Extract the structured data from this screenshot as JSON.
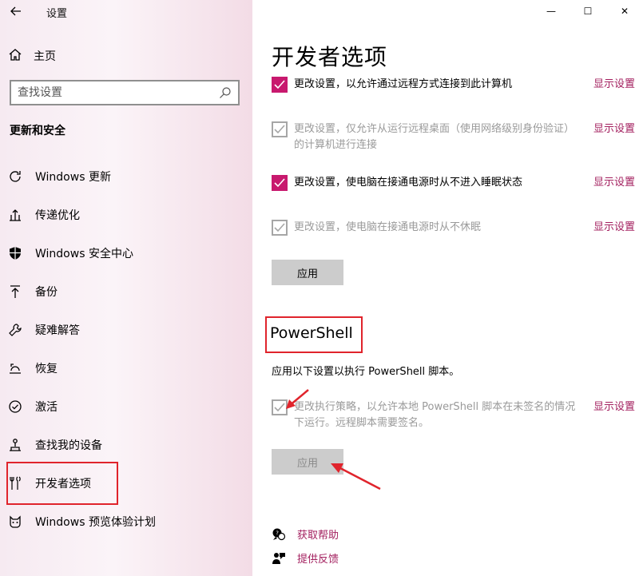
{
  "window": {
    "title": "设置",
    "minimize_glyph": "—",
    "maximize_glyph": "☐",
    "close_glyph": "✕"
  },
  "sidebar": {
    "home_label": "主页",
    "search_placeholder": "查找设置",
    "section_title": "更新和安全",
    "items": [
      {
        "label": "Windows 更新",
        "icon": "refresh-icon"
      },
      {
        "label": "传递优化",
        "icon": "upload-icon"
      },
      {
        "label": "Windows 安全中心",
        "icon": "shield-icon"
      },
      {
        "label": "备份",
        "icon": "backup-arrow-icon"
      },
      {
        "label": "疑难解答",
        "icon": "wrench-icon"
      },
      {
        "label": "恢复",
        "icon": "recovery-icon"
      },
      {
        "label": "激活",
        "icon": "check-circle-icon"
      },
      {
        "label": "查找我的设备",
        "icon": "find-device-icon"
      },
      {
        "label": "开发者选项",
        "icon": "developer-tools-icon",
        "selected": true
      },
      {
        "label": "Windows 预览体验计划",
        "icon": "insider-cat-icon"
      }
    ]
  },
  "main": {
    "page_title": "开发者选项",
    "settings": [
      {
        "text": "更改设置，以允许通过远程方式连接到此计算机",
        "state": "checked",
        "link": "显示设置"
      },
      {
        "text": "更改设置，仅允许从运行远程桌面（使用网络级别身份验证）的计算机进行连接",
        "state": "disabled",
        "link": "显示设置"
      },
      {
        "text": "更改设置，使电脑在接通电源时从不进入睡眠状态",
        "state": "checked",
        "link": "显示设置"
      },
      {
        "text": "更改设置，使电脑在接通电源时从不休眠",
        "state": "disabled",
        "link": "显示设置"
      }
    ],
    "apply_label": "应用",
    "powershell": {
      "title": "PowerShell",
      "description": "应用以下设置以执行 PowerShell 脚本。",
      "setting_text": "更改执行策略，以允许本地 PowerShell 脚本在未签名的情况下运行。远程脚本需要签名。",
      "setting_state": "disabled",
      "link": "显示设置",
      "apply_label": "应用"
    },
    "footer": {
      "help_label": "获取帮助",
      "feedback_label": "提供反馈"
    }
  },
  "colors": {
    "accent": "#c8196e",
    "link": "#a3205f",
    "annotation_red": "#e0242c"
  }
}
